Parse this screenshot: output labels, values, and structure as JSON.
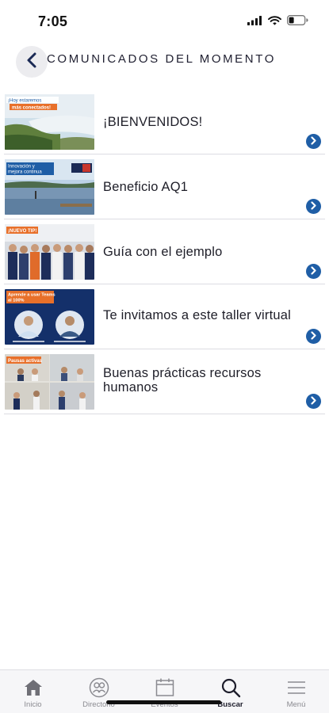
{
  "status_bar": {
    "time": "7:05"
  },
  "header": {
    "title": "COMUNICADOS DEL MOMENTO"
  },
  "news": [
    {
      "title": "¡BIENVENIDOS!",
      "thumb_text_1": "¡Hoy estaremos",
      "thumb_text_2": "más conectados!"
    },
    {
      "title": "Beneficio AQ1",
      "thumb_text_1": "Innovación y",
      "thumb_text_2": "mejora continua"
    },
    {
      "title": "Guía con el ejemplo",
      "thumb_text_1": "¡NUEVO TIP!"
    },
    {
      "title": "Te invitamos a este taller virtual",
      "thumb_text_1": "Aprende a usar Teams",
      "thumb_text_2": "al 100%"
    },
    {
      "title": "Buenas prácticas recursos humanos",
      "thumb_text_1": "Pausas activas"
    }
  ],
  "tab_bar": {
    "items": [
      {
        "label": "Inicio",
        "icon": "home-icon"
      },
      {
        "label": "Directorio",
        "icon": "directory-icon"
      },
      {
        "label": "Eventos",
        "icon": "calendar-icon"
      },
      {
        "label": "Buscar",
        "icon": "search-icon",
        "active": true
      },
      {
        "label": "Menú",
        "icon": "menu-icon"
      }
    ]
  },
  "colors": {
    "accent": "#1f5ea6",
    "title": "#222233",
    "tab_inactive": "#8a8a90"
  }
}
